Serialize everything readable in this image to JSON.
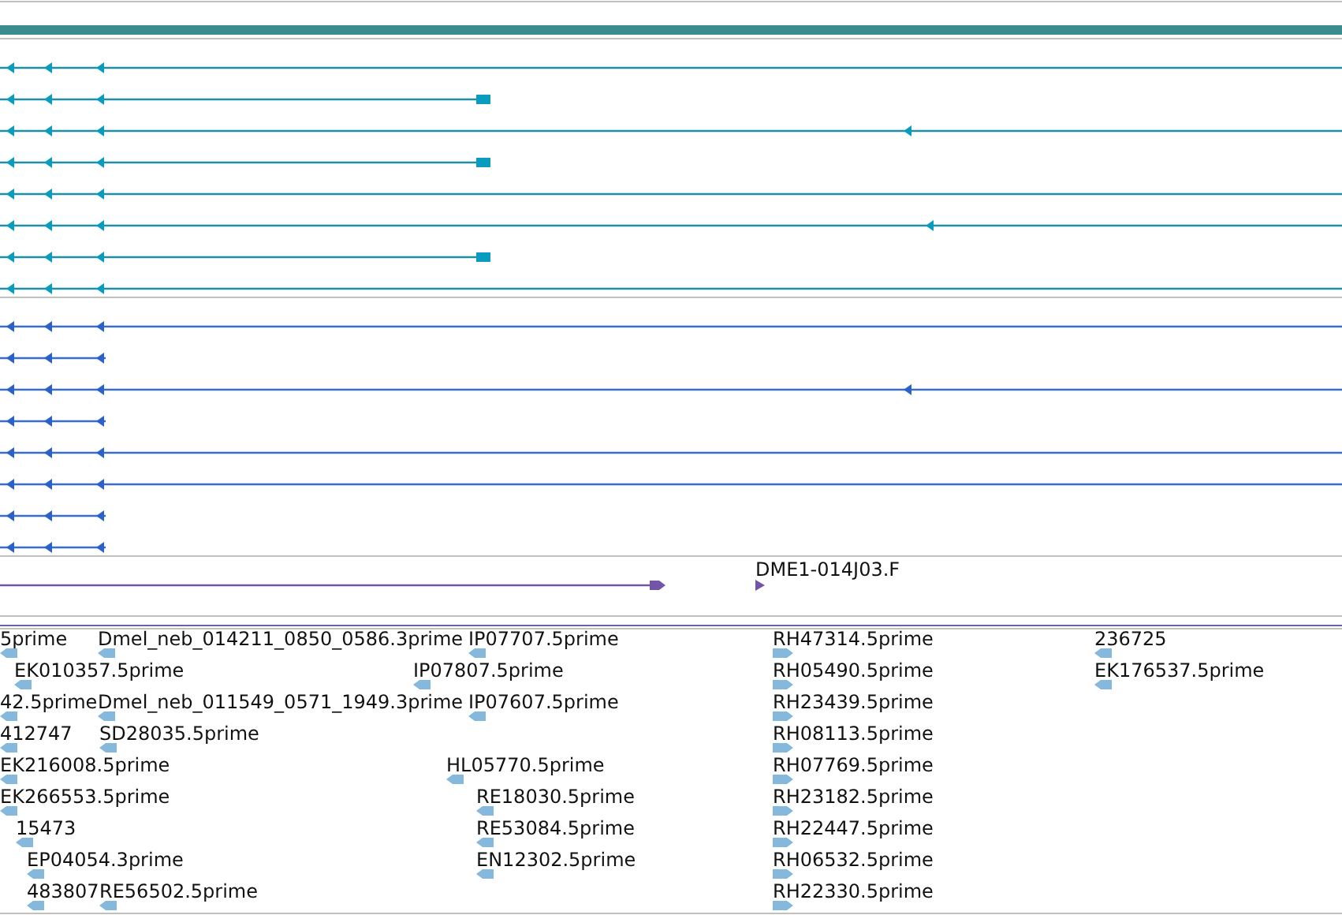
{
  "clone_label": "DME1-014J03.F",
  "est_rows": [
    {
      "labels": [
        "5prime",
        "Dmel_neb_014211_0850_0586.3prime",
        "IP07707.5prime",
        "RH47314.5prime",
        "236725"
      ]
    },
    {
      "labels": [
        "EK010357.5prime",
        "IP07807.5prime",
        "RH05490.5prime",
        "EK176537.5prime"
      ]
    },
    {
      "labels": [
        "42.5prime",
        "Dmel_neb_011549_0571_1949.3prime",
        "IP07607.5prime",
        "RH23439.5prime"
      ]
    },
    {
      "labels": [
        "412747",
        "SD28035.5prime",
        "RH08113.5prime"
      ]
    },
    {
      "labels": [
        "EK216008.5prime",
        "HL05770.5prime",
        "RH07769.5prime"
      ]
    },
    {
      "labels": [
        "EK266553.5prime",
        "RE18030.5prime",
        "RH23182.5prime"
      ]
    },
    {
      "labels": [
        "15473",
        "RE53084.5prime",
        "RH22447.5prime"
      ]
    },
    {
      "labels": [
        "EP04054.3prime",
        "EN12302.5prime",
        "RH06532.5prime"
      ]
    },
    {
      "labels": [
        "483807",
        "RE56502.5prime",
        "RH22330.5prime"
      ]
    }
  ]
}
